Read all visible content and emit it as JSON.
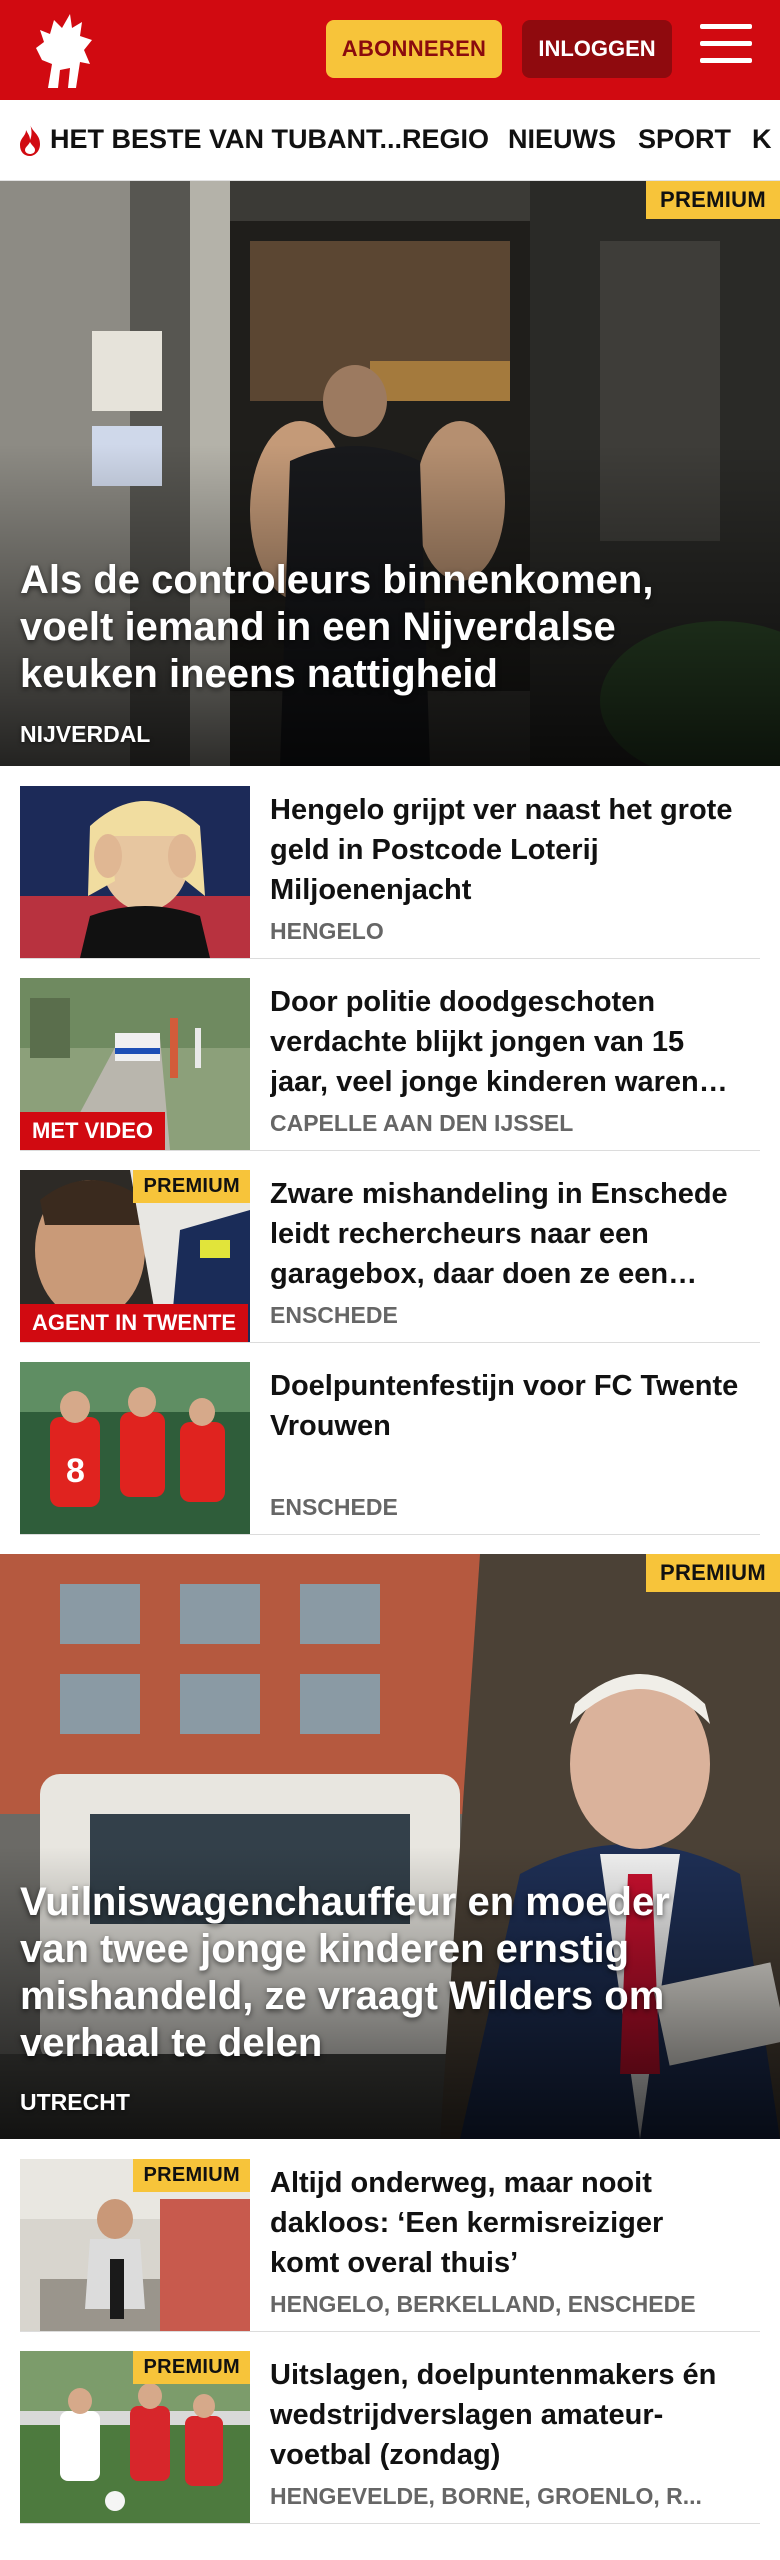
{
  "header": {
    "logo_icon": "tubantia-horse-logo",
    "subscribe_label": "ABONNEREN",
    "login_label": "INLOGGEN",
    "menu_icon": "hamburger-menu-icon",
    "colors": {
      "brand_red": "#d10a11",
      "accent_yellow": "#f7c43a",
      "login_dark_red": "#8f0a0e"
    }
  },
  "nav": {
    "items": [
      {
        "label": "HET BESTE VAN TUBANT..."
      },
      {
        "label": "REGIO"
      },
      {
        "label": "NIEUWS"
      },
      {
        "label": "SPORT"
      },
      {
        "label": "K"
      }
    ]
  },
  "hero1": {
    "badge": "PREMIUM",
    "title": "Als de controleurs binnenkomen, voelt iemand in een Nijverdalse keuken ineens nattigheid",
    "location": "NIJVERDAL"
  },
  "articles1": [
    {
      "title": "Hengelo grijpt ver naast het grote geld in Postcode Loterij Miljoenenjacht",
      "location": "HENGELO"
    },
    {
      "title": "Door politie doodgeschoten verdachte blijkt jongen van 15 jaar, veel jonge kinderen waren getuige",
      "location": "CAPELLE AAN DEN IJSSEL",
      "label": "MET VIDEO"
    },
    {
      "title": "Zware mishandeling in Enschede leidt rechercheurs naar een garagebox, daar doen ze een vondst",
      "location": "ENSCHEDE",
      "badge": "PREMIUM",
      "label": "AGENT IN TWENTE"
    },
    {
      "title": "Doelpuntenfestijn voor FC Twente Vrouwen",
      "location": "ENSCHEDE"
    }
  ],
  "hero2": {
    "badge": "PREMIUM",
    "title": "Vuilniswagenchauffeur en moeder van twee jonge kinderen ernstig mishandeld, ze vraagt Wilders om verhaal te delen",
    "location": "UTRECHT"
  },
  "articles2": [
    {
      "title": "Altijd onderweg, maar nooit dakloos: ‘Een kermisreiziger komt overal thuis’",
      "location": "HENGELO, BERKELLAND, ENSCHEDE",
      "badge": "PREMIUM"
    },
    {
      "title": "Uitslagen, doelpuntenmakers én wedstrijdverslagen amateur-voetbal (zondag)",
      "location": "HENGEVELDE, BORNE, GROENLO, R...",
      "badge": "PREMIUM"
    }
  ]
}
